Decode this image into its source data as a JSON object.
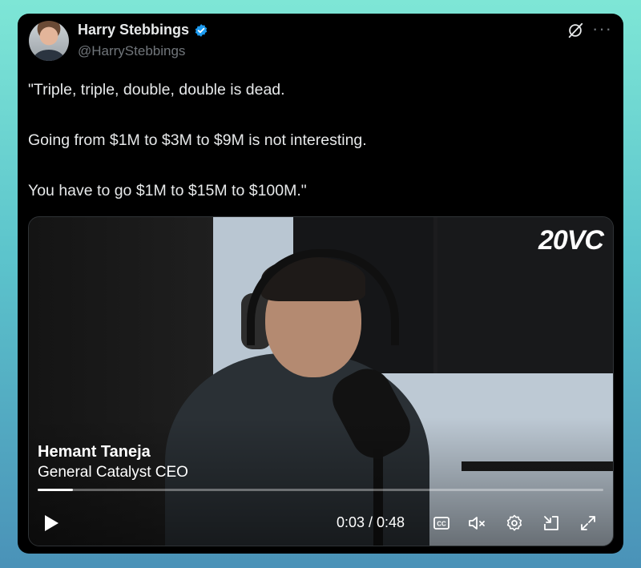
{
  "author": {
    "name": "Harry Stebbings",
    "handle": "@HarryStebbings"
  },
  "tweet": {
    "lines": [
      "\"Triple, triple, double, double is dead.",
      "Going from $1M to $3M to $9M is not interesting.",
      "You have to go $1M to $15M to $100M.\""
    ]
  },
  "video": {
    "brand": "20VC",
    "guest_name": "Hemant Taneja",
    "guest_role": "General Catalyst CEO",
    "current_time": "0:03",
    "duration": "0:48",
    "time_display": "0:03 / 0:48",
    "progress": 0.0625
  },
  "icons": {
    "verified": "verified-badge-icon",
    "grok": "grok-icon",
    "more": "more-options-icon",
    "play": "play-icon",
    "captions": "cc-icon",
    "mute": "muted-speaker-icon",
    "settings": "gear-icon",
    "pip": "picture-in-picture-icon",
    "fullscreen": "fullscreen-icon"
  },
  "colors": {
    "background": "#000000",
    "text": "#e7e9ea",
    "secondary": "#71767b",
    "verified": "#1d9bf0"
  }
}
